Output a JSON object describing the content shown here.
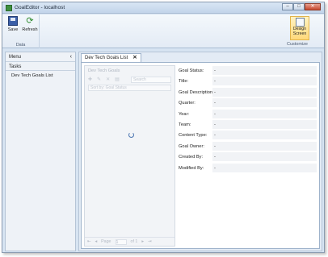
{
  "window": {
    "title": "GoalEditor - localhost",
    "minimize": "–",
    "maximize": "□",
    "close": "✕"
  },
  "ribbon": {
    "data_group": "Data",
    "save": "Save",
    "refresh": "Refresh",
    "design_screen": "Design Screen",
    "customize_group": "Customize"
  },
  "menu": {
    "header": "Menu",
    "collapse": "‹",
    "section": "Tasks",
    "items": [
      "Dev Tech Goals List"
    ]
  },
  "tab": {
    "label": "Dev Tech Goals List",
    "close": "✕"
  },
  "list": {
    "title": "Dev Tech Goals",
    "search_placeholder": "Search",
    "sort_label": "Sort by: Goal Status",
    "pager": {
      "first": "⇤",
      "prev": "◂",
      "page_label": "Page",
      "page_value": "1",
      "of_label": "of 1",
      "next": "▸",
      "last": "⇥"
    }
  },
  "details": [
    {
      "label": "Goal Status:",
      "value": "-"
    },
    {
      "label": "Title:",
      "value": "-"
    },
    {
      "label": "Goal Description:",
      "value": "-"
    },
    {
      "label": "Quarter:",
      "value": "-"
    },
    {
      "label": "Year:",
      "value": "-"
    },
    {
      "label": "Team:",
      "value": "-"
    },
    {
      "label": "Content Type:",
      "value": "-"
    },
    {
      "label": "Goal Owner:",
      "value": "-"
    },
    {
      "label": "Created By:",
      "value": "-"
    },
    {
      "label": "Modified By:",
      "value": "-"
    }
  ]
}
